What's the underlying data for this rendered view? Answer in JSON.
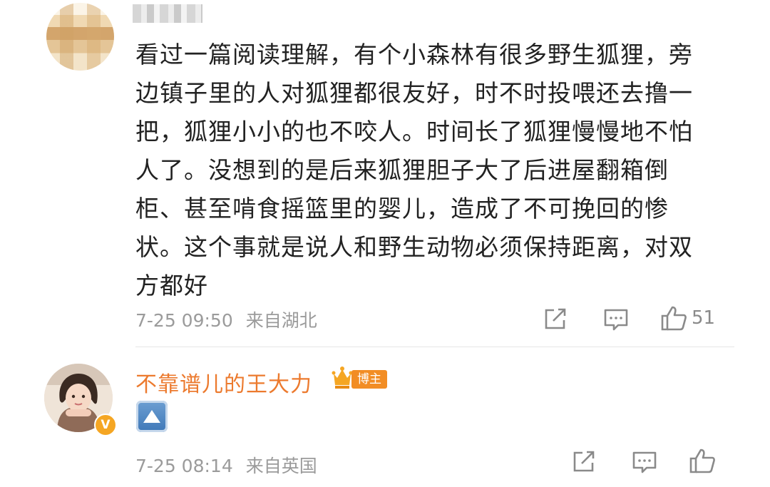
{
  "comment1": {
    "text": "看过一篇阅读理解，有个小森林有很多野生狐狸，旁边镇子里的人对狐狸都很友好，时不时投喂还去撸一把，狐狸小小的也不咬人。时间长了狐狸慢慢地不怕人了。没想到的是后来狐狸胆子大了后进屋翻箱倒柜、甚至啃食摇篮里的婴儿，造成了不可挽回的惨状。这个事就是说人和野生动物必须保持距离，对双方都好",
    "time": "7-25 09:50",
    "location": "来自湖北",
    "like_count": "51"
  },
  "comment2": {
    "username": "不靠谱儿的王大力",
    "badge": "博主",
    "time": "7-25 08:14",
    "location": "来自英国"
  },
  "colors": {
    "username": "#ec7a2e",
    "badge_bg": "#f28d24",
    "meta_text": "#9b9b9b",
    "body_text": "#222222"
  },
  "icons": [
    "share-icon",
    "comment-icon",
    "like-icon",
    "up-arrow-emoji",
    "crown-icon",
    "verified-v-icon"
  ]
}
